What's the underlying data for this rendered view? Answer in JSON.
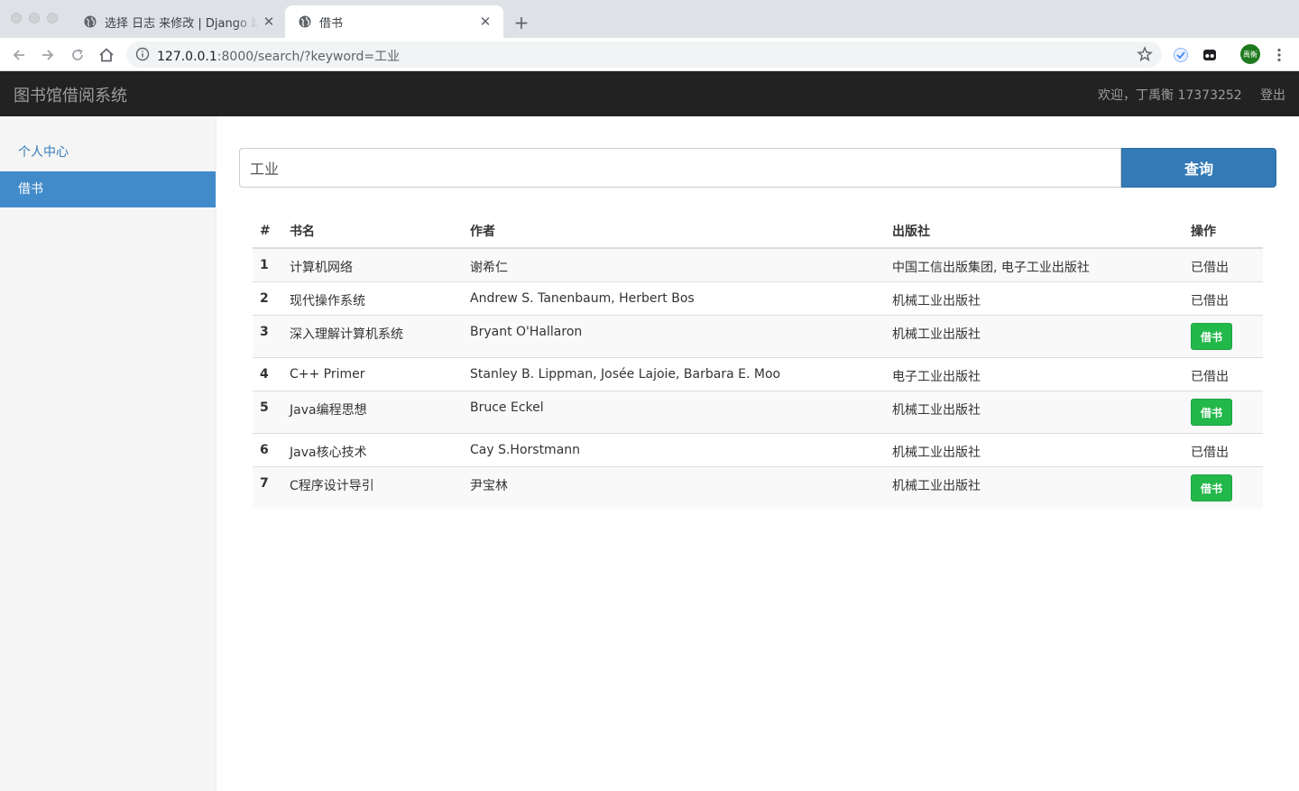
{
  "browser": {
    "tabs": [
      {
        "title": "选择 日志 来修改 | Django 站点管理"
      },
      {
        "title": "借书"
      }
    ],
    "url_host": "127.0.0.1",
    "url_rest": ":8000/search/?keyword=工业",
    "profile_label": "禹衡"
  },
  "navbar": {
    "brand": "图书馆借阅系统",
    "welcome": "欢迎，丁禹衡 17373252",
    "logout": "登出"
  },
  "sidebar": {
    "items": [
      {
        "label": "个人中心"
      },
      {
        "label": "借书"
      }
    ]
  },
  "search": {
    "value": "工业",
    "button_label": "查询"
  },
  "table": {
    "headers": [
      "#",
      "书名",
      "作者",
      "出版社",
      "操作"
    ],
    "rows": [
      {
        "num": "1",
        "title": "计算机网络",
        "author": "谢希仁",
        "publisher": "中国工信出版集团, 电子工业出版社",
        "op": "已借出"
      },
      {
        "num": "2",
        "title": "现代操作系统",
        "author": "Andrew S. Tanenbaum, Herbert Bos",
        "publisher": "机械工业出版社",
        "op": "已借出"
      },
      {
        "num": "3",
        "title": "深入理解计算机系统",
        "author": "Bryant O'Hallaron",
        "publisher": "机械工业出版社",
        "op": "借书"
      },
      {
        "num": "4",
        "title": "C++ Primer",
        "author": "Stanley B. Lippman, Josée Lajoie, Barbara E. Moo",
        "publisher": "电子工业出版社",
        "op": "已借出"
      },
      {
        "num": "5",
        "title": "Java编程思想",
        "author": "Bruce Eckel",
        "publisher": "机械工业出版社",
        "op": "借书"
      },
      {
        "num": "6",
        "title": "Java核心技术",
        "author": "Cay S.Horstmann",
        "publisher": "机械工业出版社",
        "op": "已借出"
      },
      {
        "num": "7",
        "title": "C程序设计导引",
        "author": "尹宝林",
        "publisher": "机械工业出版社",
        "op": "借书"
      }
    ]
  },
  "colors": {
    "navbar_bg": "#222222",
    "primary": "#337ab7",
    "sidebar_active": "#428bca",
    "success": "#22b84a"
  }
}
